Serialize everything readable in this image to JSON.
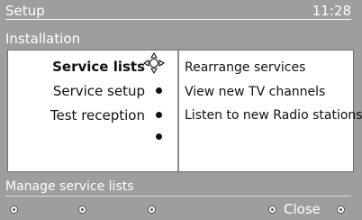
{
  "header": {
    "title": "Setup",
    "time": "11:28"
  },
  "subtitle": "Installation",
  "menu": {
    "items": [
      {
        "label": "Service lists",
        "selected": true
      },
      {
        "label": "Service setup",
        "selected": false
      },
      {
        "label": "Test reception",
        "selected": false
      }
    ]
  },
  "options": [
    "Rearrange services",
    "View new TV channels",
    "Listen to new Radio stations"
  ],
  "help_text": "Manage service lists",
  "footer": {
    "close_label": "Close"
  },
  "icons": {
    "cursor": "navigation-cursor-icon"
  }
}
